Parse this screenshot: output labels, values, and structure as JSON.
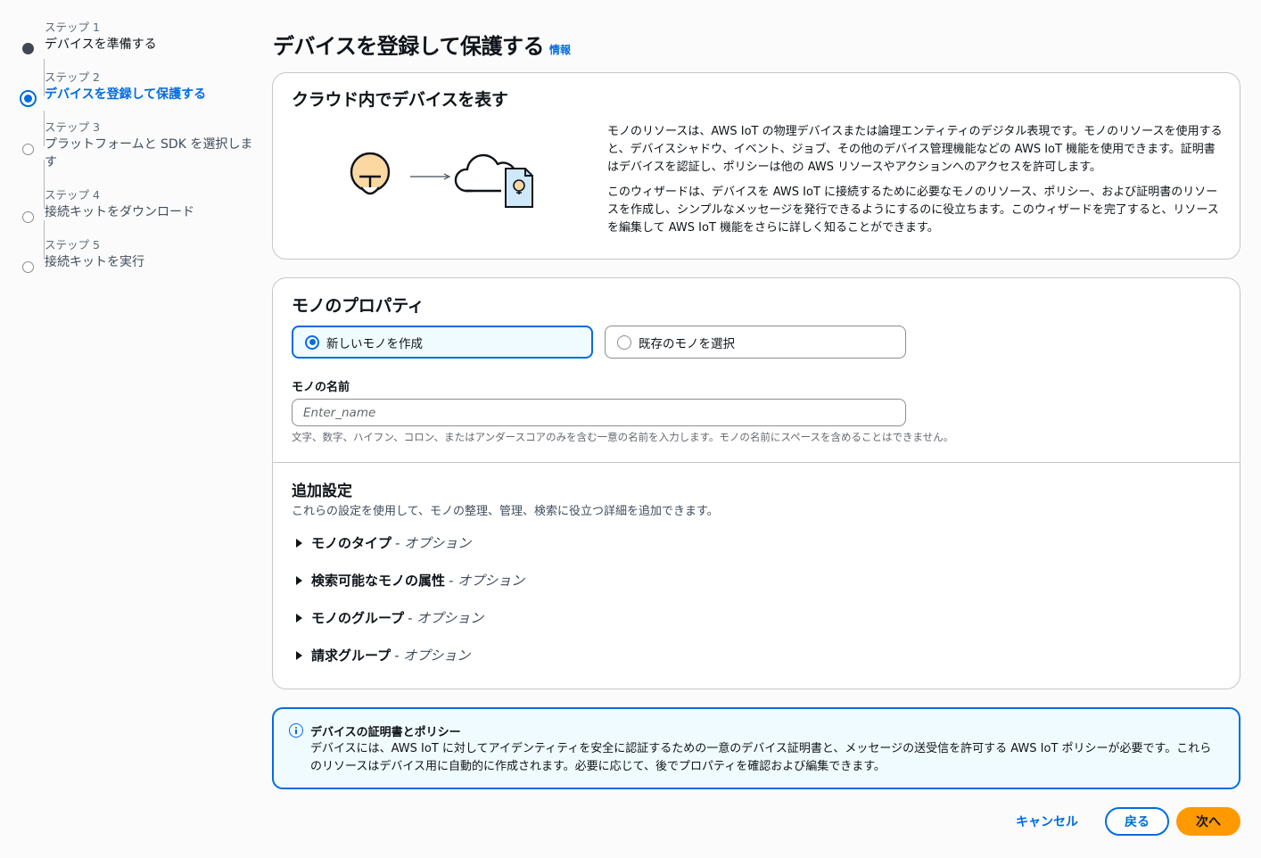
{
  "steps": [
    {
      "num": "ステップ 1",
      "title": "デバイスを準備する",
      "state": "done"
    },
    {
      "num": "ステップ 2",
      "title": "デバイスを登録して保護する",
      "state": "current"
    },
    {
      "num": "ステップ 3",
      "title": "プラットフォームと SDK を選択しま\nす",
      "state": "todo"
    },
    {
      "num": "ステップ 4",
      "title": "接続キットをダウンロード",
      "state": "todo"
    },
    {
      "num": "ステップ 5",
      "title": "接続キットを実行",
      "state": "todo"
    }
  ],
  "header": {
    "title": "デバイスを登録して保護する",
    "info_link": "情報"
  },
  "represent": {
    "title": "クラウド内でデバイスを表す",
    "para1": "モノのリソースは、AWS IoT の物理デバイスまたは論理エンティティのデジタル表現です。モノのリソースを使用すると、デバイスシャドウ、イベント、ジョブ、その他のデバイス管理機能などの AWS IoT 機能を使用できます。証明書はデバイスを認証し、ポリシーは他の AWS リソースやアクションへのアクセスを許可します。",
    "para2": "このウィザードは、デバイスを AWS IoT に接続するために必要なモノのリソース、ポリシー、および証明書のリソースを作成し、シンプルなメッセージを発行できるようにするのに役立ちます。このウィザードを完了すると、リソースを編集して AWS IoT 機能をさらに詳しく知ることができます。"
  },
  "properties": {
    "title": "モノのプロパティ",
    "option_new": "新しいモノを作成",
    "option_existing": "既存のモノを選択",
    "name_label": "モノの名前",
    "name_placeholder": "Enter_name",
    "name_hint": "文字、数字、ハイフン、コロン、またはアンダースコアのみを含む一意の名前を入力します。モノの名前にスペースを含めることはできません。"
  },
  "additional": {
    "title": "追加設定",
    "description": "これらの設定を使用して、モノの整理、管理、検索に役立つ詳細を追加できます。",
    "sections": [
      {
        "label": "モノのタイプ",
        "suffix": "- オプション"
      },
      {
        "label": "検索可能なモノの属性",
        "suffix": "- オプション"
      },
      {
        "label": "モノのグループ",
        "suffix": "- オプション"
      },
      {
        "label": "請求グループ",
        "suffix": "- オプション"
      }
    ]
  },
  "alert": {
    "title": "デバイスの証明書とポリシー",
    "body": "デバイスには、AWS IoT に対してアイデンティティを安全に認証するための一意のデバイス証明書と、メッセージの送受信を許可する AWS IoT ポリシーが必要です。これらのリソースはデバイス用に自動的に作成されます。必要に応じて、後でプロパティを確認および編集できます。"
  },
  "footer": {
    "cancel": "キャンセル",
    "back": "戻る",
    "next": "次へ"
  },
  "colors": {
    "accent": "#006ce0",
    "primary_button": "#ff9900",
    "info_bg": "#f0fbff"
  }
}
